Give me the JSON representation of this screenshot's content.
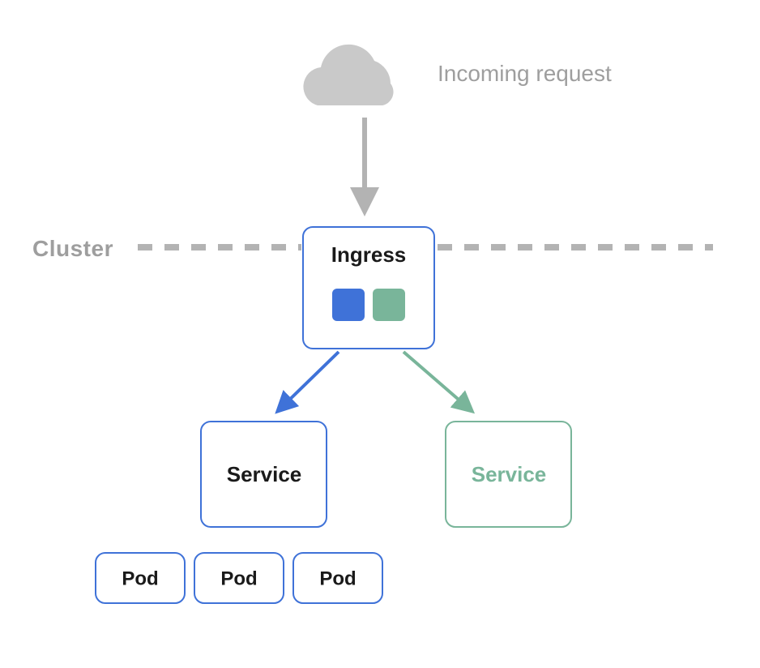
{
  "diagram": {
    "incoming_label": "Incoming request",
    "cluster_label": "Cluster",
    "ingress_label": "Ingress",
    "service_blue_label": "Service",
    "service_green_label": "Service",
    "pods": [
      "Pod",
      "Pod",
      "Pod"
    ],
    "colors": {
      "blue": "#3f72d8",
      "green": "#79b59a",
      "gray": "#b3b3b3"
    }
  }
}
